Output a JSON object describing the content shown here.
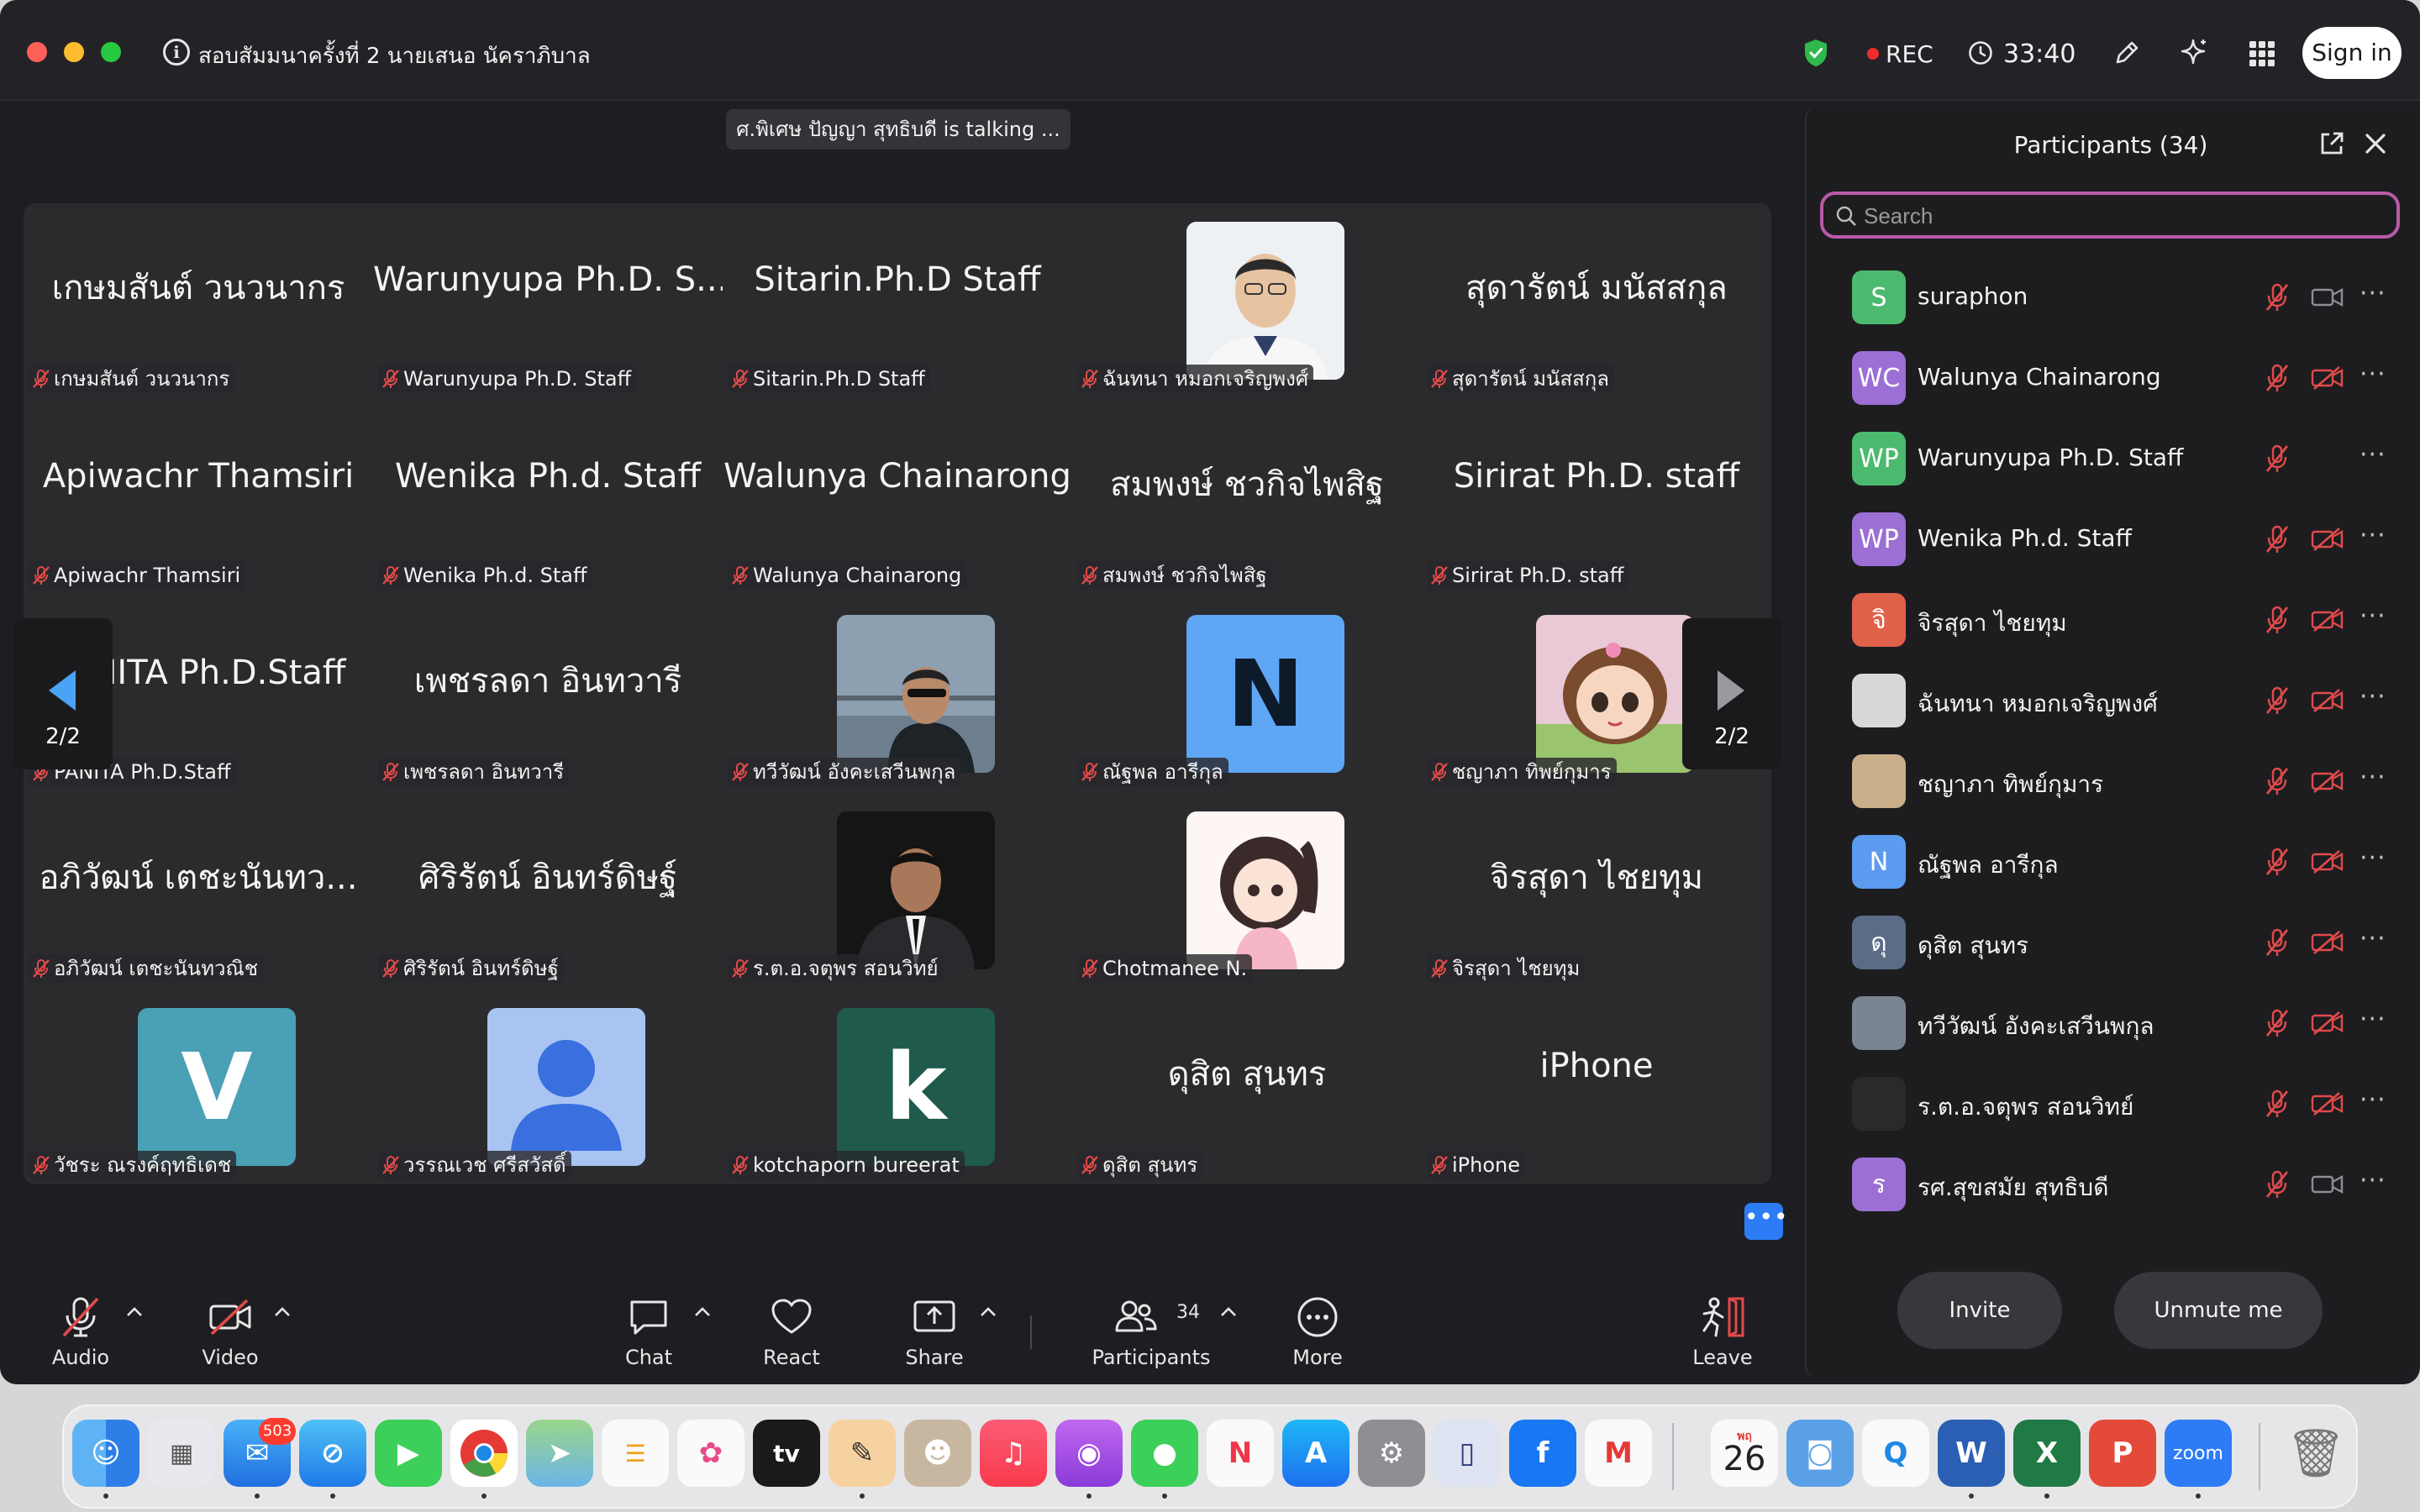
{
  "title_bar": {
    "meeting_title": "สอบสัมมนาครั้งที่ 2   นายเสนอ นัคราภิบาล",
    "rec_label": "REC",
    "timer": "33:40",
    "sign_in_label": "Sign in"
  },
  "talking_banner": "ศ.พิเศษ ปัญญา สุทธิบดี is talking ...",
  "gallery": {
    "tiles": [
      {
        "big": "เกษมสันต์ วนวนากร",
        "label": "เกษมสันต์ วนวนากร"
      },
      {
        "big": "Warunyupa Ph.D. S...",
        "label": "Warunyupa Ph.D. Staff"
      },
      {
        "big": "Sitarin.Ph.D Staff",
        "label": "Sitarin.Ph.D Staff"
      },
      {
        "big": "",
        "label": "ฉันทนา หมอกเจริญพงศ์"
      },
      {
        "big": "สุดารัตน์  มนัสสกุล",
        "label": "สุดารัตน์  มนัสสกุล"
      },
      {
        "big": "Apiwachr Thamsiri",
        "label": "Apiwachr Thamsiri"
      },
      {
        "big": "Wenika Ph.d. Staff",
        "label": "Wenika Ph.d. Staff"
      },
      {
        "big": "Walunya Chainarong",
        "label": "Walunya Chainarong"
      },
      {
        "big": "สมพงษ์ ชวกิจไพสิฐ",
        "label": "สมพงษ์ ชวกิจไพสิฐ"
      },
      {
        "big": "Sirirat Ph.D. staff",
        "label": "Sirirat Ph.D. staff"
      },
      {
        "big": "PANITA Ph.D.Staff",
        "label": "PANITA Ph.D.Staff"
      },
      {
        "big": "เพชรลดา อินทวารี",
        "label": "เพชรลดา อินทวารี"
      },
      {
        "big": "",
        "label": "ทวีวัฒน์ อังคะเสวีนพกุล"
      },
      {
        "big": "",
        "label": "ณัฐพล อารีกุล",
        "letter": "N"
      },
      {
        "big": "",
        "label": "ชญาภา ทิพย์กุมาร"
      },
      {
        "big": "อภิวัฒน์ เตชะนันทว...",
        "label": "อภิวัฒน์ เตชะนันทวณิช"
      },
      {
        "big": "ศิริรัตน์ อินทร์ดิษฐ์",
        "label": "ศิริรัตน์ อินทร์ดิษฐ์"
      },
      {
        "big": "",
        "label": "ร.ต.อ.จตุพร   สอนวิทย์"
      },
      {
        "big": "",
        "label": "Chotmanee N."
      },
      {
        "big": "จิรสุดา  ไชยทุม",
        "label": "จิรสุดา  ไชยทุม"
      },
      {
        "big": "",
        "label": "วัชระ ณรงค์ฤทธิเดช",
        "letter": "V"
      },
      {
        "big": "",
        "label": "วรรณเวช ศรีสวัสดิ์"
      },
      {
        "big": "",
        "label": "kotchaporn bureerat",
        "letter": "k"
      },
      {
        "big": "ดุสิต  สุนทร",
        "label": "ดุสิต  สุนทร"
      },
      {
        "big": "iPhone",
        "label": "iPhone"
      }
    ],
    "page_indicator_left": "2/2",
    "page_indicator_right": "2/2",
    "more_label": "•••"
  },
  "participants_panel": {
    "title": "Participants (34)",
    "search_placeholder": "Search",
    "participants": [
      {
        "initials": "S",
        "name": "suraphon",
        "color": "#4cba6e",
        "video": "on"
      },
      {
        "initials": "WC",
        "name": "Walunya Chainarong",
        "color": "#9b6fd4",
        "video": "off"
      },
      {
        "initials": "WP",
        "name": "Warunyupa Ph.D. Staff",
        "color": "#4cba6e",
        "video": "none"
      },
      {
        "initials": "WP",
        "name": "Wenika Ph.d. Staff",
        "color": "#9b6fd4",
        "video": "off"
      },
      {
        "initials": "จิ",
        "name": "จิรสุดา  ไชยทุม",
        "color": "#e0614a",
        "video": "off"
      },
      {
        "initials": "",
        "name": "ฉันทนา หมอกเจริญพงศ์",
        "color": "#d8d8d8",
        "video": "off"
      },
      {
        "initials": "",
        "name": "ชญาภา ทิพย์กุมาร",
        "color": "#c9b08a",
        "video": "off"
      },
      {
        "initials": "N",
        "name": "ณัฐพล อารีกุล",
        "color": "#5b9cf0",
        "video": "off"
      },
      {
        "initials": "ดุ",
        "name": "ดุสิต  สุนทร",
        "color": "#5a6c86",
        "video": "off"
      },
      {
        "initials": "",
        "name": "ทวีวัฒน์ อังคะเสวีนพกุล",
        "color": "#7a8591",
        "video": "off"
      },
      {
        "initials": "",
        "name": "ร.ต.อ.จตุพร   สอนวิทย์",
        "color": "#2a2a2a",
        "video": "off"
      },
      {
        "initials": "ร",
        "name": "รศ.สุขสมัย สุทธิบดี",
        "color": "#9b6fd4",
        "video": "on"
      }
    ],
    "invite_label": "Invite",
    "unmute_label": "Unmute me"
  },
  "toolbar": {
    "audio": "Audio",
    "video": "Video",
    "chat": "Chat",
    "react": "React",
    "share": "Share",
    "participants": "Participants",
    "participants_count": "34",
    "more": "More",
    "leave": "Leave"
  },
  "dock": {
    "mail_badge": "503",
    "calendar_day": "26",
    "calendar_month": "พฤ",
    "tv_label": "tv",
    "zoom_label": "zoom",
    "apps": [
      "finder",
      "launchpad",
      "mail",
      "safari",
      "facetime",
      "chrome",
      "maps",
      "reminders",
      "photos",
      "apple-tv",
      "goodnotes",
      "contacts",
      "music",
      "podcasts",
      "messages",
      "news",
      "app-store",
      "system-settings",
      "iphone-mirroring",
      "facebook",
      "gmail",
      "calendar",
      "storage",
      "quick-search",
      "word",
      "excel",
      "acrobat",
      "zoom",
      "trash"
    ]
  }
}
